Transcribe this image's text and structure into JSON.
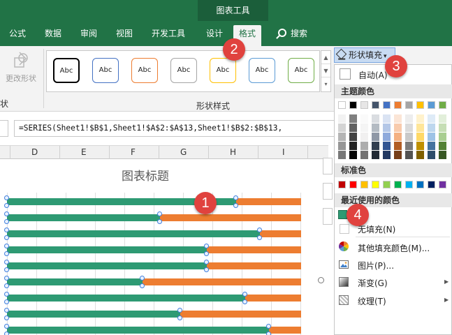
{
  "ribbon": {
    "context_title": "图表工具",
    "tabs": [
      "公式",
      "数据",
      "审阅",
      "视图",
      "开发工具",
      "设计",
      "格式"
    ],
    "active_tab": "格式",
    "search_label": "搜索",
    "change_shape_label": "更改形状",
    "left_group_label": "状",
    "style_gallery_label": "形状样式",
    "style_box_text": "Abc",
    "style_colors": [
      "#000000",
      "#4472c4",
      "#ed7d31",
      "#a5a5a5",
      "#ffc000",
      "#5b9bd5",
      "#70ad47"
    ]
  },
  "formula_bar": {
    "formula": "=SERIES(Sheet1!$B$1,Sheet1!$A$2:$A$13,Sheet1!$B$2:$B$13,"
  },
  "columns": [
    "D",
    "E",
    "F",
    "G",
    "H",
    "I"
  ],
  "chart": {
    "title": "图表标题",
    "green_color": "#2e9a73",
    "orange_color": "#ed7d31",
    "bars_green_fraction": [
      0.78,
      0.52,
      0.86,
      0.68,
      0.68,
      0.46,
      0.81,
      0.59,
      0.89
    ]
  },
  "shape_fill_menu": {
    "button_label": "形状填充",
    "auto_label": "自动(A)",
    "theme_colors_label": "主题颜色",
    "theme_colors": [
      "#ffffff",
      "#000000",
      "#e7e6e6",
      "#44546a",
      "#4472c4",
      "#ed7d31",
      "#a5a5a5",
      "#ffc000",
      "#5b9bd5",
      "#70ad47"
    ],
    "standard_colors_label": "标准色",
    "standard_colors": [
      "#c00000",
      "#ff0000",
      "#ffc000",
      "#ffff00",
      "#92d050",
      "#00b050",
      "#00b0f0",
      "#0070c0",
      "#002060",
      "#7030a0"
    ],
    "recent_label": "最近使用的颜色",
    "recent_color": "#2e9a73",
    "no_fill_label": "无填充(N)",
    "more_colors_label": "其他填充颜色(M)...",
    "picture_label": "图片(P)...",
    "gradient_label": "渐变(G)",
    "texture_label": "纹理(T)"
  },
  "callouts": [
    "1",
    "2",
    "3",
    "4"
  ]
}
